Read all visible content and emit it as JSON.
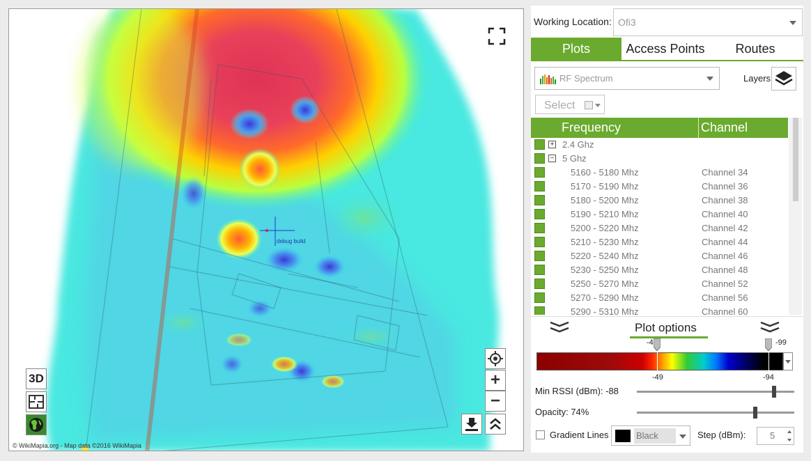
{
  "map": {
    "attribution": "© WikiMapia.org - Map data ©2016 WikiMapia",
    "debug_label": "debug build",
    "btn_3d": "3D",
    "zoom_in": "+",
    "zoom_out": "−",
    "icons": [
      "fullscreen-icon",
      "floorplan-icon",
      "globe-icon",
      "locate-icon",
      "download-icon",
      "double-chevron-up-icon"
    ]
  },
  "panel": {
    "working_location_label": "Working Location:",
    "working_location_value": "Ofi3",
    "tabs": [
      {
        "label": "Plots",
        "active": true
      },
      {
        "label": "Access Points",
        "active": false
      },
      {
        "label": "Routes",
        "active": false
      }
    ],
    "plot_type": "RF Spectrum",
    "layers_label": "Layers",
    "select_label": "Select",
    "grid": {
      "headers": {
        "frequency": "Frequency",
        "channel": "Channel"
      },
      "groups": [
        {
          "toggle": "+",
          "label": "2.4 Ghz"
        },
        {
          "toggle": "−",
          "label": "5 Ghz"
        }
      ],
      "rows": [
        {
          "freq": "5160 - 5180 Mhz",
          "channel": "Channel 34"
        },
        {
          "freq": "5170 - 5190 Mhz",
          "channel": "Channel 36"
        },
        {
          "freq": "5180 - 5200 Mhz",
          "channel": "Channel 38"
        },
        {
          "freq": "5190 - 5210 Mhz",
          "channel": "Channel 40"
        },
        {
          "freq": "5200 - 5220 Mhz",
          "channel": "Channel 42"
        },
        {
          "freq": "5210 - 5230 Mhz",
          "channel": "Channel 44"
        },
        {
          "freq": "5220 - 5240 Mhz",
          "channel": "Channel 46"
        },
        {
          "freq": "5230 - 5250 Mhz",
          "channel": "Channel 48"
        },
        {
          "freq": "5250 - 5270 Mhz",
          "channel": "Channel 52"
        },
        {
          "freq": "5270 - 5290 Mhz",
          "channel": "Channel 56"
        },
        {
          "freq": "5290 - 5310 Mhz",
          "channel": "Channel 60"
        }
      ]
    },
    "plot_options": {
      "label": "Plot options",
      "gradient": {
        "top_left": "-4",
        "top_right": "-99",
        "bottom_left": "-49",
        "bottom_right": "-94"
      },
      "min_rssi_label": "Min RSSI (dBm): -88",
      "min_rssi_value": -88,
      "opacity_label": "Opacity: 74%",
      "opacity_value": 0.74,
      "gradient_lines_label": "Gradient Lines",
      "gradient_lines_checked": false,
      "line_color_name": "Black",
      "line_color": "#000000",
      "step_label": "Step (dBm):",
      "step_value": "5"
    },
    "accent_color": "#6aaa2e"
  }
}
